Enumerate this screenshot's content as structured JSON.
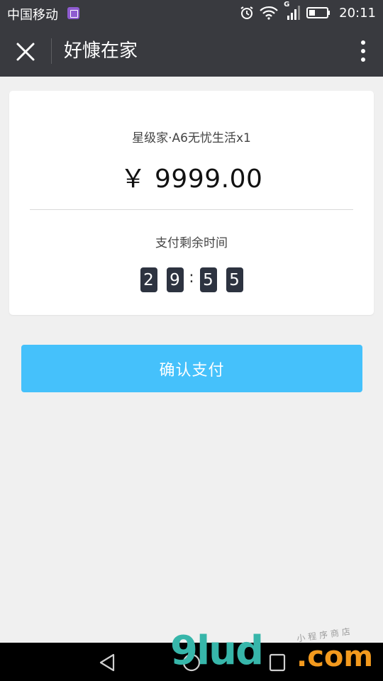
{
  "status_bar": {
    "carrier": "中国移动",
    "network": "G",
    "time": "20:11",
    "icons": [
      "gallery-icon",
      "alarm-icon",
      "wifi-icon",
      "signal-icon",
      "battery-icon"
    ]
  },
  "nav": {
    "title": "好慷在家",
    "icons": [
      "close-icon",
      "more-icon"
    ]
  },
  "order": {
    "product": "星级家·A6无忧生活x1",
    "price": "￥ 9999.00"
  },
  "countdown": {
    "label": "支付剩余时间",
    "digits": [
      "2",
      "9",
      "5",
      "5"
    ],
    "separator": ":"
  },
  "actions": {
    "confirm_label": "确认支付"
  },
  "colors": {
    "header_bg": "#393a3f",
    "button": "#45c1fb",
    "digit_bg": "#2d3340",
    "page_bg": "#f0f0f0"
  },
  "watermark": {
    "brand": "9lud",
    "suffix": ".com",
    "tagline": "小程序商店"
  }
}
